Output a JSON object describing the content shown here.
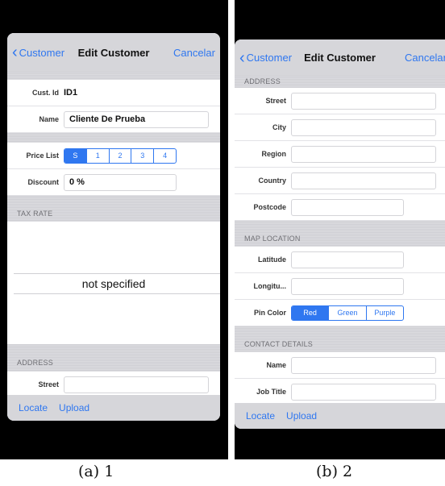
{
  "panel_a": {
    "nav": {
      "back": "Customer",
      "title": "Edit Customer",
      "right": "Cancelar"
    },
    "cust_id": {
      "label": "Cust. Id",
      "value": "ID1"
    },
    "name": {
      "label": "Name",
      "value": "Cliente De Prueba"
    },
    "price_list": {
      "label": "Price List",
      "options": [
        "S",
        "1",
        "2",
        "3",
        "4"
      ],
      "selected": "S"
    },
    "discount": {
      "label": "Discount",
      "value": "0 %"
    },
    "tax_rate_header": "TAX RATE",
    "tax_picker_value": "not specified",
    "address_header": "ADDRESS",
    "street": {
      "label": "Street",
      "value": ""
    },
    "toolbar": {
      "locate": "Locate",
      "upload": "Upload"
    }
  },
  "panel_b": {
    "nav": {
      "back": "Customer",
      "title": "Edit Customer",
      "right": "Cancelar"
    },
    "address_header": "ADDRESS",
    "street": {
      "label": "Street"
    },
    "city": {
      "label": "City"
    },
    "region": {
      "label": "Region"
    },
    "country": {
      "label": "Country"
    },
    "postcode": {
      "label": "Postcode"
    },
    "map_header": "MAP LOCATION",
    "latitude": {
      "label": "Latitude"
    },
    "longitude": {
      "label": "Longitu..."
    },
    "pin_color": {
      "label": "Pin Color",
      "options": [
        "Red",
        "Green",
        "Purple"
      ],
      "selected": "Red"
    },
    "contact_header": "CONTACT DETAILS",
    "contact_name": {
      "label": "Name"
    },
    "job_title": {
      "label": "Job Title"
    },
    "toolbar": {
      "locate": "Locate",
      "upload": "Upload"
    }
  },
  "captions": {
    "a": "(a) 1",
    "b": "(b) 2"
  },
  "colors": {
    "accent": "#2f77f0",
    "navbar": "#d6d6da",
    "section": "#dcdce0"
  }
}
